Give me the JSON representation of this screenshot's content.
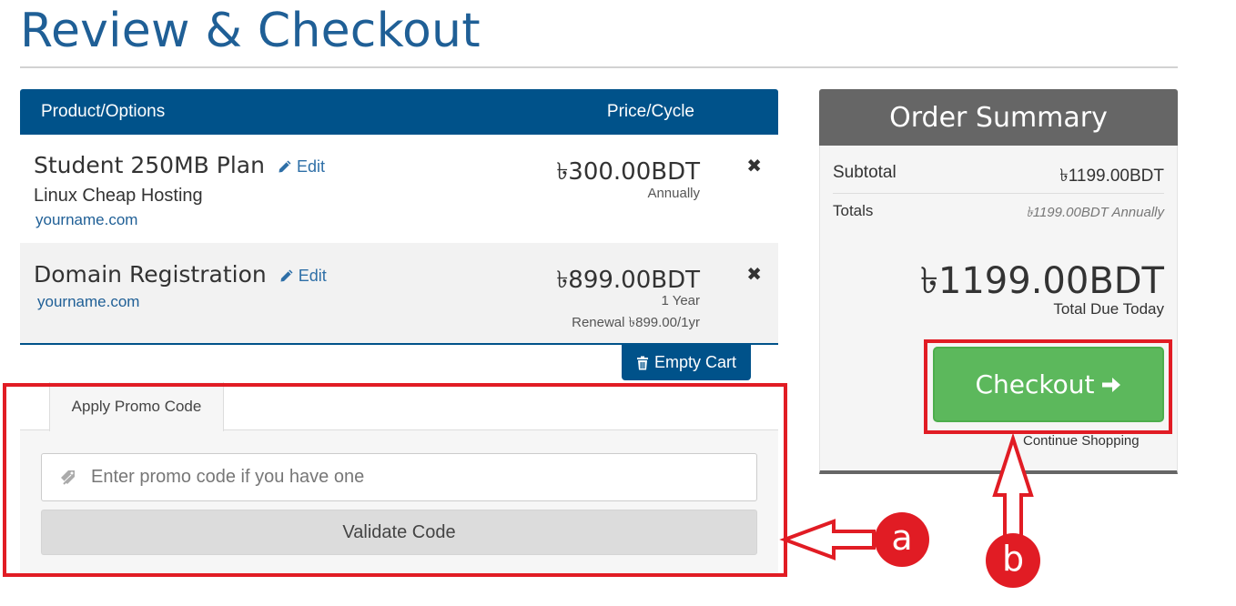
{
  "page": {
    "title": "Review & Checkout"
  },
  "cart": {
    "header": {
      "product_label": "Product/Options",
      "price_label": "Price/Cycle"
    },
    "items": [
      {
        "name": "Student 250MB Plan",
        "edit_label": "Edit",
        "group": "Linux Cheap Hosting",
        "domain": "yourname.com",
        "price": "৳300.00BDT",
        "cycle": "Annually",
        "remove_icon": "close-icon"
      },
      {
        "name": "Domain Registration",
        "edit_label": "Edit",
        "domain": "yourname.com",
        "price": "৳899.00BDT",
        "cycle": "1 Year",
        "renewal": "Renewal ৳899.00/1yr",
        "remove_icon": "close-icon"
      }
    ],
    "empty_cart_label": "Empty Cart"
  },
  "promo": {
    "tab_label": "Apply Promo Code",
    "input_placeholder": "Enter promo code if you have one",
    "validate_label": "Validate Code"
  },
  "summary": {
    "title": "Order Summary",
    "subtotal_label": "Subtotal",
    "subtotal_value": "৳1199.00BDT",
    "totals_label": "Totals",
    "totals_value": "৳1199.00BDT Annually",
    "total_due": "৳1199.00BDT",
    "total_due_label": "Total Due Today",
    "checkout_label": "Checkout",
    "continue_label": "Continue Shopping"
  },
  "annotations": {
    "a_label": "a",
    "b_label": "b",
    "color": "#e11c24"
  },
  "colors": {
    "primary": "#00528a",
    "checkout": "#5cb85c",
    "summary_header": "#666666"
  }
}
